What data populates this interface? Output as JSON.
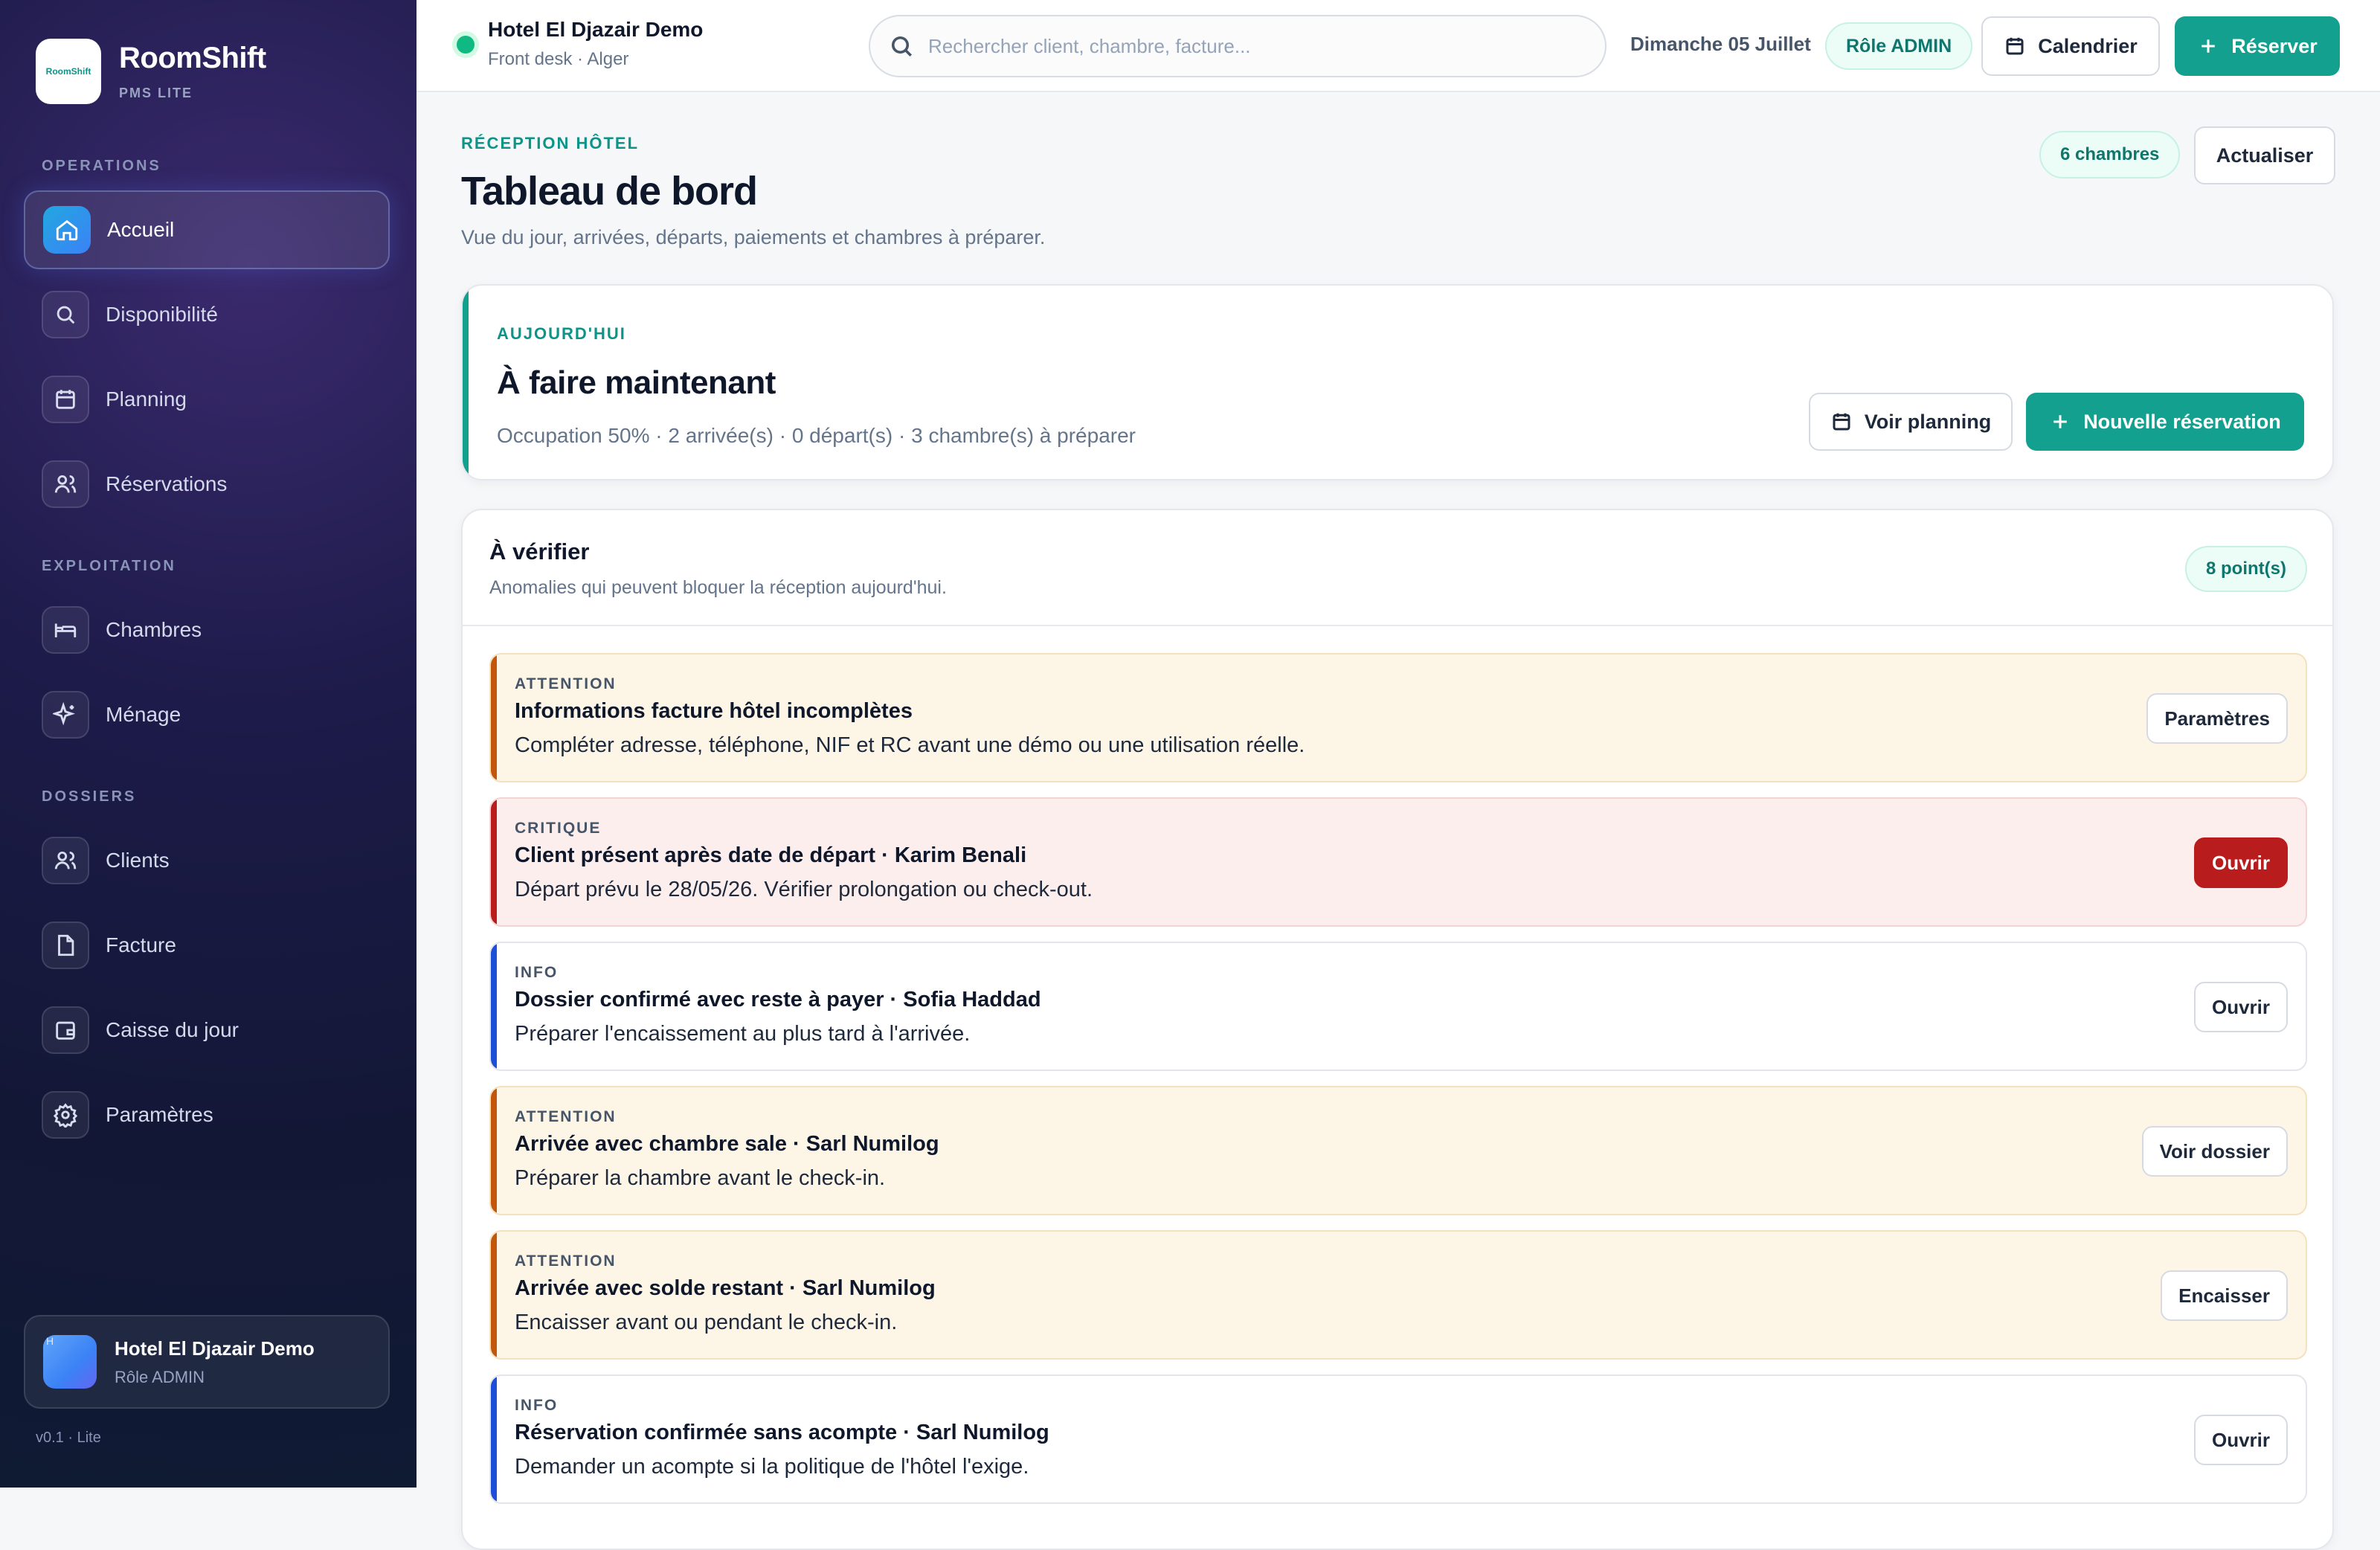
{
  "brand": {
    "name": "RoomShift",
    "sub": "PMS LITE",
    "logo_text": "RoomShift"
  },
  "sections": {
    "operations": "OPERATIONS",
    "exploitation": "EXPLOITATION",
    "dossiers": "DOSSIERS"
  },
  "nav": {
    "accueil": "Accueil",
    "disponibilite": "Disponibilité",
    "planning": "Planning",
    "reservations": "Réservations",
    "chambres": "Chambres",
    "menage": "Ménage",
    "clients": "Clients",
    "facture": "Facture",
    "caisse": "Caisse du jour",
    "parametres": "Paramètres"
  },
  "sidebar_hotel": {
    "name": "Hotel El Djazair Demo",
    "role": "Rôle ADMIN",
    "avatar_letter": "H"
  },
  "version": "v0.1 · Lite",
  "topbar": {
    "hotel": "Hotel El Djazair Demo",
    "sub": "Front desk · Alger",
    "search_placeholder": "Rechercher client, chambre, facture...",
    "date": "Dimanche 05 Juillet",
    "role": "Rôle ADMIN",
    "calendar_btn": "Calendrier",
    "reserve_btn": "Réserver"
  },
  "header": {
    "eyebrow": "RÉCEPTION HÔTEL",
    "title": "Tableau de bord",
    "subtitle": "Vue du jour, arrivées, départs, paiements et chambres à préparer.",
    "rooms_pill": "6 chambres",
    "refresh_btn": "Actualiser"
  },
  "today": {
    "eyebrow": "AUJOURD'HUI",
    "title": "À faire maintenant",
    "summary": "Occupation 50% · 2 arrivée(s) · 0 départ(s) · 3 chambre(s) à préparer",
    "planning_btn": "Voir planning",
    "new_btn": "Nouvelle réservation"
  },
  "verify": {
    "title": "À vérifier",
    "subtitle": "Anomalies qui peuvent bloquer la réception aujourd'hui.",
    "count": "8 point(s)",
    "alerts": [
      {
        "level": "ATTENTION",
        "title": "Informations facture hôtel incomplètes",
        "desc": "Compléter adresse, téléphone, NIF et RC avant une démo ou une utilisation réelle.",
        "action": "Paramètres"
      },
      {
        "level": "CRITIQUE",
        "title": "Client présent après date de départ · Karim Benali",
        "desc": "Départ prévu le 28/05/26. Vérifier prolongation ou check-out.",
        "action": "Ouvrir"
      },
      {
        "level": "INFO",
        "title": "Dossier confirmé avec reste à payer · Sofia Haddad",
        "desc": "Préparer l'encaissement au plus tard à l'arrivée.",
        "action": "Ouvrir"
      },
      {
        "level": "ATTENTION",
        "title": "Arrivée avec chambre sale · Sarl Numilog",
        "desc": "Préparer la chambre avant le check-in.",
        "action": "Voir dossier"
      },
      {
        "level": "ATTENTION",
        "title": "Arrivée avec solde restant · Sarl Numilog",
        "desc": "Encaisser avant ou pendant le check-in.",
        "action": "Encaisser"
      },
      {
        "level": "INFO",
        "title": "Réservation confirmée sans acompte · Sarl Numilog",
        "desc": "Demander un acompte si la politique de l'hôtel l'exige.",
        "action": "Ouvrir"
      }
    ]
  }
}
